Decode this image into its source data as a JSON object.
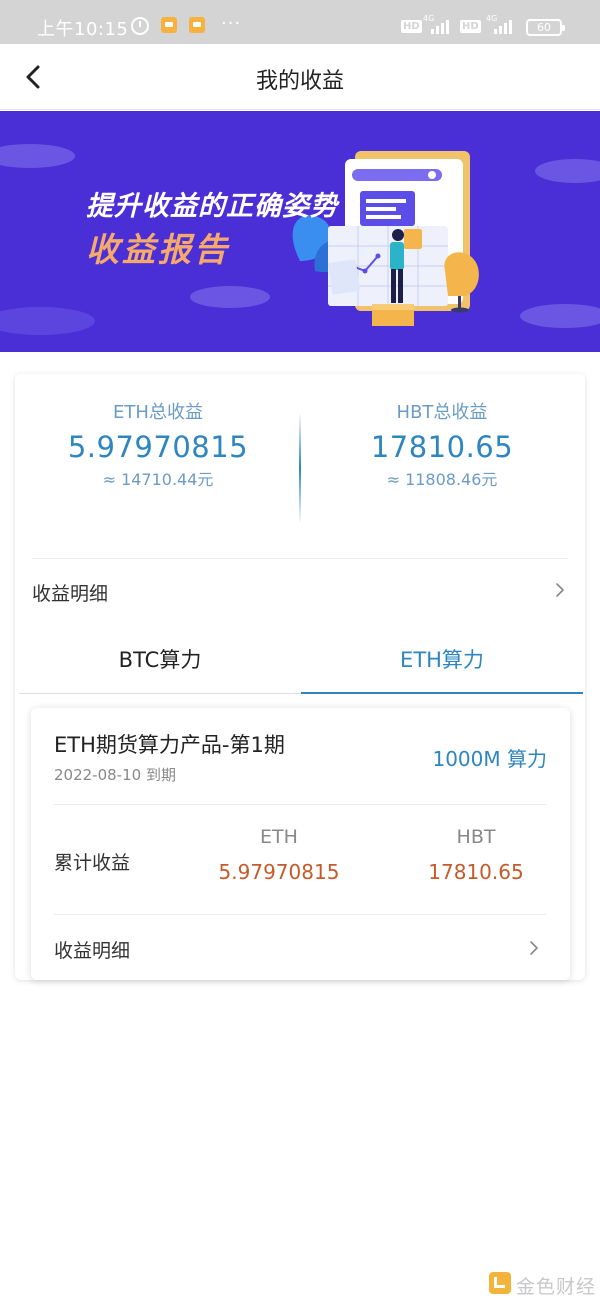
{
  "status_bar": {
    "time": "上午10:15",
    "more": "···",
    "hd1": "HD",
    "hd2": "HD",
    "network1": "4G",
    "network2": "4G",
    "battery": "60",
    "icons": [
      "alarm-icon",
      "notification-icon",
      "notification-icon",
      "more-icon",
      "hd-icon",
      "signal-icon",
      "hd-icon",
      "signal-icon",
      "battery-icon"
    ]
  },
  "nav": {
    "title": "我的收益",
    "back_icon": "chevron-left-icon"
  },
  "banner": {
    "line1": "提升收益的正确姿势",
    "line2": "收益报告"
  },
  "summary": {
    "eth": {
      "label": "ETH总收益",
      "value": "5.97970815",
      "approx": "≈ 14710.44元"
    },
    "hbt": {
      "label": "HBT总收益",
      "value": "17810.65",
      "approx": "≈ 11808.46元"
    },
    "detail_label": "收益明细"
  },
  "tabs": [
    {
      "label": "BTC算力",
      "active": false
    },
    {
      "label": "ETH算力",
      "active": true
    }
  ],
  "product": {
    "name": "ETH期货算力产品-第1期",
    "date": "2022-08-10 到期",
    "power": "1000M 算力",
    "cumulative_label": "累计收益",
    "eth_head": "ETH",
    "eth_value": "5.97970815",
    "hbt_head": "HBT",
    "hbt_value": "17810.65",
    "detail_label": "收益明细"
  },
  "watermark": {
    "text": "金色财经"
  },
  "colors": {
    "accent": "#2e86c1",
    "banner_bg": "#4a2fd6",
    "banner_accent": "#f6a96b",
    "earnings_orange": "#c55a2a",
    "status_bar_bg": "#d4d4d4"
  }
}
